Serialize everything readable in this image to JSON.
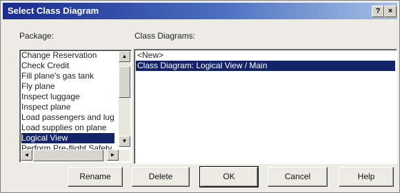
{
  "window": {
    "title": "Select Class Diagram",
    "help_label": "?",
    "close_label": "×"
  },
  "package": {
    "label": "Package:",
    "items": [
      "Change Reservation",
      "Check Credit",
      "Fill plane's gas tank",
      "Fly plane",
      "Inspect luggage",
      "Inspect plane",
      "Load passengers and lug",
      "Load supplies on plane",
      "Logical View",
      "Perform Pre-flight Safety"
    ],
    "selected_index": 8
  },
  "class_diagrams": {
    "label": "Class Diagrams:",
    "items": [
      "<New>",
      "Class Diagram: Logical View / Main"
    ],
    "selected_index": 1
  },
  "buttons": {
    "rename": "Rename",
    "delete": "Delete",
    "ok": "OK",
    "cancel": "Cancel",
    "help": "Help"
  },
  "icons": {
    "scroll_up": "▲",
    "scroll_down": "▼",
    "scroll_left": "◄",
    "scroll_right": "►"
  }
}
